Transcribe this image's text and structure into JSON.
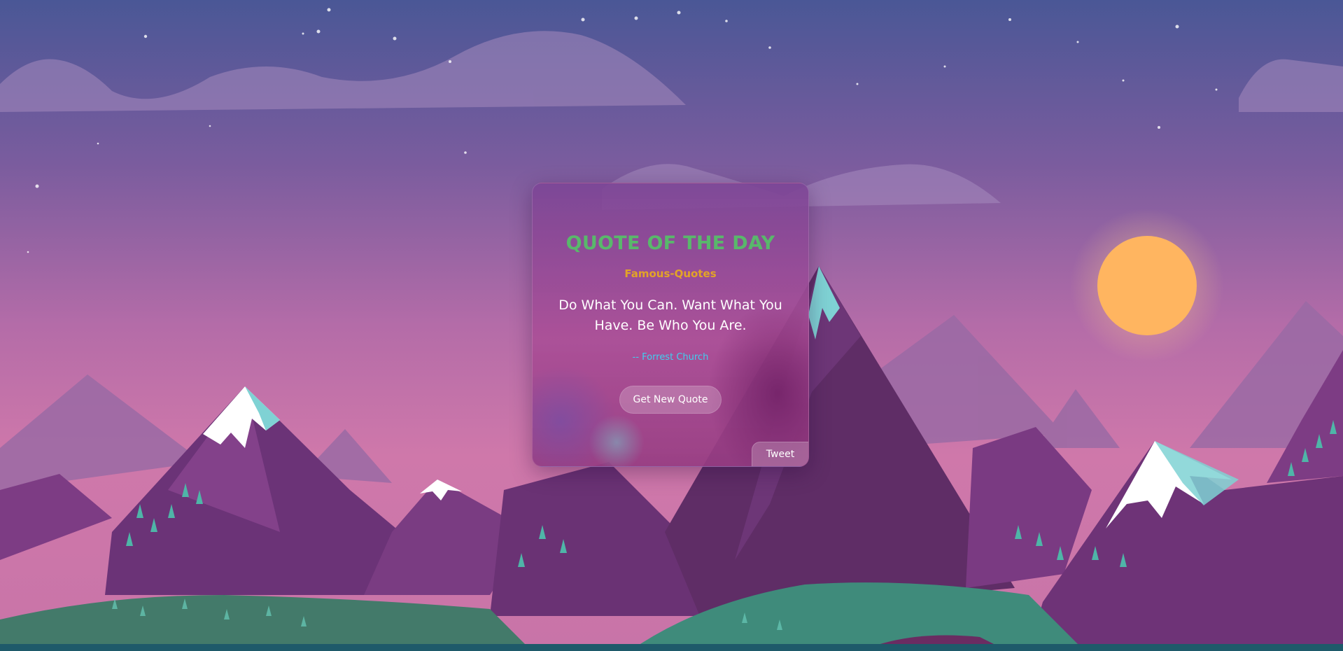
{
  "card": {
    "title": "QUOTE OF THE DAY",
    "subtitle": "Famous-Quotes",
    "quote": "Do What You Can. Want What You Have. Be Who You Are.",
    "author": "-- Forrest Church",
    "new_quote_label": "Get New Quote",
    "tweet_label": "Tweet"
  },
  "colors": {
    "title": "#59b86b",
    "subtitle": "#e3a427",
    "author": "#3fd0f0",
    "sun": "#ffb560"
  },
  "icons": {
    "sun": "sun-icon",
    "stars": "star-icon",
    "mountains": "mountain-icon",
    "trees": "tree-icon"
  }
}
